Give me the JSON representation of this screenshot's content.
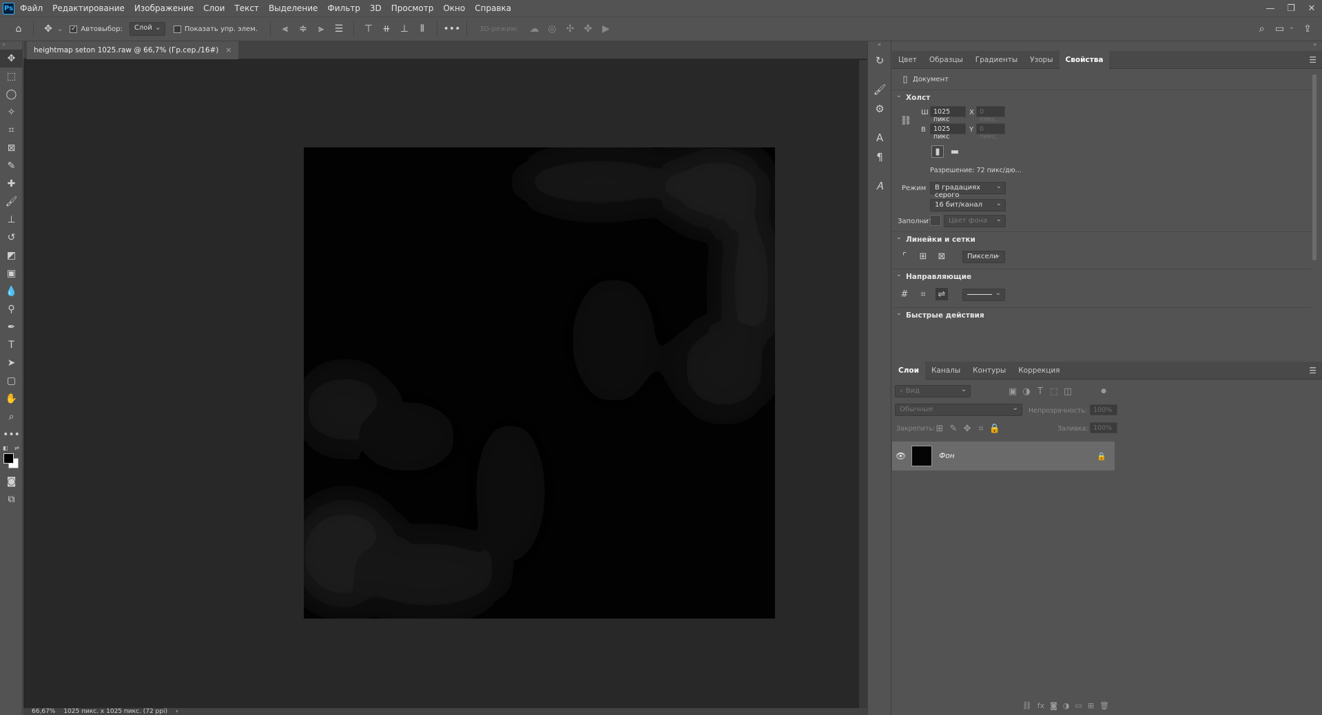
{
  "app": {
    "logo": "Ps"
  },
  "menu": [
    "Файл",
    "Редактирование",
    "Изображение",
    "Слои",
    "Текст",
    "Выделение",
    "Фильтр",
    "3D",
    "Просмотр",
    "Окно",
    "Справка"
  ],
  "window_controls": {
    "minimize": "—",
    "restore": "❐",
    "close": "✕"
  },
  "options": {
    "autoselect_label": "Автовыбор:",
    "autoselect_value": "Слой",
    "show_transform_label": "Показать упр. элем.",
    "mode3d_label": "3D-режим:",
    "more": "•••"
  },
  "document": {
    "tab_title": "heightmap seton 1025.raw @ 66,7% (Гр.сер./16#)",
    "close": "×"
  },
  "status": {
    "zoom": "66,67%",
    "info": "1025 пикс. x 1025 пикс. (72 ppi)",
    "arrow": "›"
  },
  "properties_panel": {
    "tabs": [
      "Цвет",
      "Образцы",
      "Градиенты",
      "Узоры",
      "Свойства"
    ],
    "active_tab": "Свойства",
    "doc_label": "Документ",
    "canvas_section": "Холст",
    "width_label": "Ш",
    "width_value": "1025 пикс",
    "height_label": "В",
    "height_value": "1025 пикс",
    "x_label": "X",
    "x_placeholder": "0 пикс.",
    "y_label": "Y",
    "y_placeholder": "0 пикс.",
    "resolution": "Разрешение: 72 пикс/дю...",
    "mode_label": "Режим",
    "mode_value": "В градациях серого",
    "depth_value": "16 бит/канал",
    "fill_label": "Заполнить",
    "fill_value": "Цвет фона",
    "rulers_section": "Линейки и сетки",
    "units_value": "Пиксели",
    "guides_section": "Направляющие",
    "quick_section": "Быстрые действия"
  },
  "layers_panel": {
    "tabs": [
      "Слои",
      "Каналы",
      "Контуры",
      "Коррекция"
    ],
    "active_tab": "Слои",
    "search_placeholder": "Вид",
    "blend_mode": "Обычные",
    "opacity_label": "Непрозрачность:",
    "opacity_value": "100%",
    "lock_label": "Закрепить:",
    "fill_label": "Заливка:",
    "fill_value": "100%",
    "layer_name": "Фон"
  }
}
